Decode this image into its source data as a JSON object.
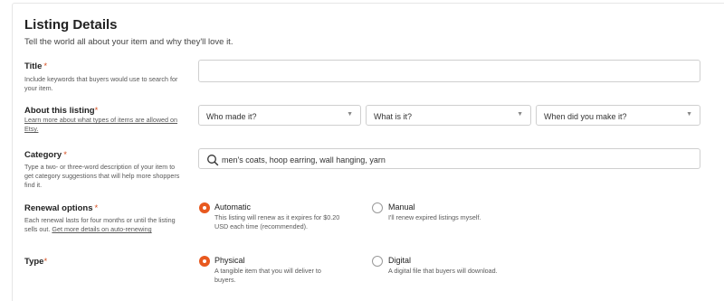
{
  "section": {
    "title": "Listing Details",
    "subtitle": "Tell the world all about your item and why they'll love it."
  },
  "title_field": {
    "label": "Title",
    "required_mark": "*",
    "help": "Include keywords that buyers would use to search for your item.",
    "value": ""
  },
  "about": {
    "label": "About this listing",
    "required_mark": "*",
    "help_link": "Learn more about what types of items are allowed on Etsy.",
    "who_made": "Who made it?",
    "what_is": "What is it?",
    "when_made": "When did you make it?"
  },
  "category": {
    "label": "Category",
    "required_mark": "*",
    "help": "Type a two- or three-word description of your item to get category suggestions that will help more shoppers find it.",
    "placeholder": "men's coats, hoop earring, wall hanging, yarn"
  },
  "renewal": {
    "label": "Renewal options",
    "required_mark": "*",
    "help": "Each renewal lasts for four months or until the listing sells out.",
    "help_link": "Get more details on auto-renewing",
    "auto_title": "Automatic",
    "auto_desc": "This listing will renew as it expires for $0.20 USD each time (recommended).",
    "auto_selected": true,
    "manual_title": "Manual",
    "manual_desc": "I'll renew expired listings myself.",
    "manual_selected": false
  },
  "type": {
    "label": "Type",
    "required_mark": "*",
    "physical_title": "Physical",
    "physical_desc": "A tangible item that you will deliver to buyers.",
    "physical_selected": true,
    "digital_title": "Digital",
    "digital_desc": "A digital file that buyers will download.",
    "digital_selected": false
  },
  "colors": {
    "accent": "#e8591f",
    "required": "#d64d1f",
    "border": "#cfcfcf"
  }
}
